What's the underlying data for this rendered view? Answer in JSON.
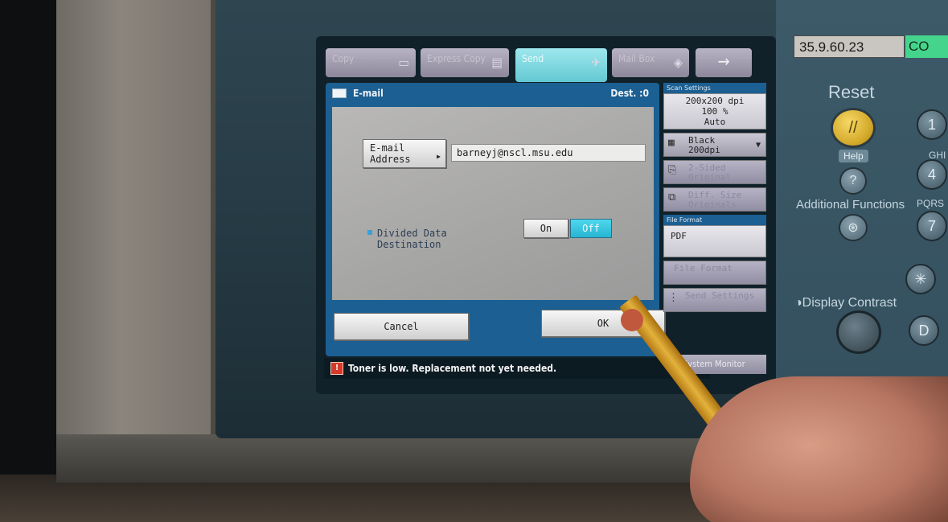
{
  "device_label": {
    "ip": "35.9.60.23",
    "tag": "CO"
  },
  "tabs": [
    {
      "label": "Copy",
      "icon": "copy-icon"
    },
    {
      "label": "Express Copy",
      "icon": "express-copy-icon"
    },
    {
      "label": "Send",
      "icon": "send-plane-icon"
    },
    {
      "label": "Mail Box",
      "icon": "mailbox-icon"
    },
    {
      "label": "→",
      "icon": "arrow-right-icon"
    }
  ],
  "dialog": {
    "title": "E-mail",
    "dest": "Dest. :0",
    "email_button": {
      "line1": "E-mail",
      "line2": "Address"
    },
    "email_value": "barneyj@nscl.msu.edu",
    "divided": {
      "line1": "Divided Data",
      "line2": "Destination"
    },
    "on_label": "On",
    "off_label": "Off",
    "cancel_label": "Cancel",
    "ok_label": "OK"
  },
  "scan_settings": {
    "header": "Scan Settings",
    "resolution": "200x200 dpi",
    "zoom": "100 %",
    "mode": "Auto",
    "color_line1": "Black",
    "color_line2": "200dpi",
    "two_sided": "2-Sided Original",
    "diff_size": "Diff. Size Originals",
    "file_format_header": "File Format",
    "file_format": "PDF",
    "file_format_button": "File Format",
    "send_settings": "Send Settings"
  },
  "status": {
    "message": "Toner is low. Replacement not yet needed.",
    "system_monitor": "System Monitor"
  },
  "hardware": {
    "reset": "Reset",
    "help": "Help",
    "additional_functions": "Additional Functions",
    "display_contrast": "◑Display Contrast",
    "ghi": "GHI",
    "pqrs": "PQRS",
    "key1": "1",
    "key4": "4",
    "key7": "7",
    "key_star": "✳",
    "key_d": "D",
    "help_glyph": "?",
    "addfn_glyph": "⊛",
    "reset_glyph": "//"
  },
  "colors": {
    "accent_active": "#63c8d2",
    "dialog_blue": "#1c5f92",
    "warning": "#d63a2a"
  }
}
